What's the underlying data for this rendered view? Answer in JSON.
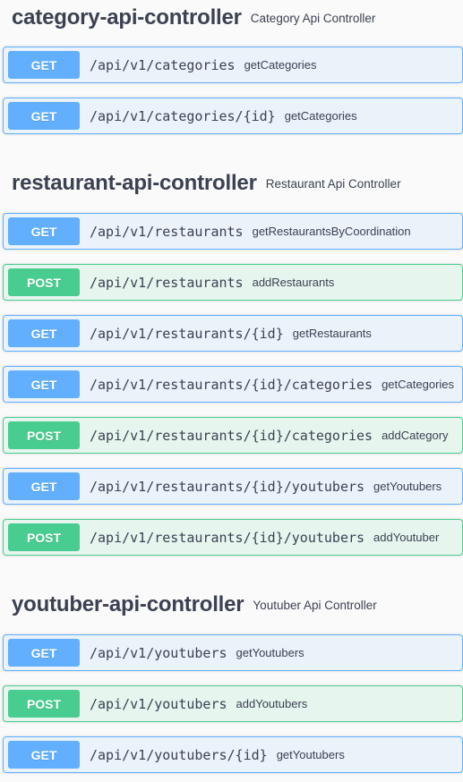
{
  "sections": [
    {
      "title": "category-api-controller",
      "description": "Category Api Controller",
      "operations": [
        {
          "method": "GET",
          "path": "/api/v1/categories",
          "summary": "getCategories"
        },
        {
          "method": "GET",
          "path": "/api/v1/categories/{id}",
          "summary": "getCategories"
        }
      ]
    },
    {
      "title": "restaurant-api-controller",
      "description": "Restaurant Api Controller",
      "operations": [
        {
          "method": "GET",
          "path": "/api/v1/restaurants",
          "summary": "getRestaurantsByCoordination"
        },
        {
          "method": "POST",
          "path": "/api/v1/restaurants",
          "summary": "addRestaurants"
        },
        {
          "method": "GET",
          "path": "/api/v1/restaurants/{id}",
          "summary": "getRestaurants"
        },
        {
          "method": "GET",
          "path": "/api/v1/restaurants/{id}/categories",
          "summary": "getCategories"
        },
        {
          "method": "POST",
          "path": "/api/v1/restaurants/{id}/categories",
          "summary": "addCategory"
        },
        {
          "method": "GET",
          "path": "/api/v1/restaurants/{id}/youtubers",
          "summary": "getYoutubers"
        },
        {
          "method": "POST",
          "path": "/api/v1/restaurants/{id}/youtubers",
          "summary": "addYoutuber"
        }
      ]
    },
    {
      "title": "youtuber-api-controller",
      "description": "Youtuber Api Controller",
      "operations": [
        {
          "method": "GET",
          "path": "/api/v1/youtubers",
          "summary": "getYoutubers"
        },
        {
          "method": "POST",
          "path": "/api/v1/youtubers",
          "summary": "addYoutubers"
        },
        {
          "method": "GET",
          "path": "/api/v1/youtubers/{id}",
          "summary": "getYoutubers"
        }
      ]
    }
  ],
  "colors": {
    "get": "#61affe",
    "post": "#49cc90",
    "text": "#3b4151",
    "background": "#fafafa"
  }
}
